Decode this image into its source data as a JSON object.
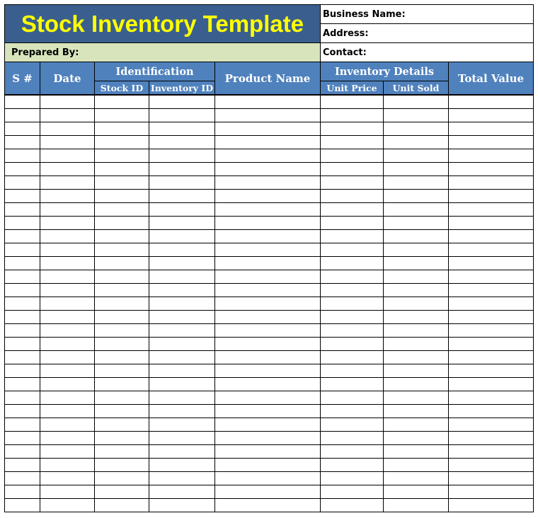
{
  "title": "Stock Inventory Template",
  "info": {
    "business_name_label": "Business Name:",
    "address_label": "Address:",
    "contact_label": "Contact:",
    "prepared_by_label": "Prepared By:"
  },
  "columns": {
    "sno": "S #",
    "date": "Date",
    "identification": "Identification",
    "stock_id": "Stock ID",
    "inventory_id": "Inventory ID",
    "product_name": "Product Name",
    "inventory_details": "Inventory Details",
    "unit_price": "Unit Price",
    "unit_sold": "Unit Sold",
    "total_value": "Total Value"
  },
  "colors": {
    "title_bg": "#3a5f8f",
    "title_text": "#ffff00",
    "header_bg": "#4f81bd",
    "prepared_bg": "#d8e4bc"
  },
  "row_count": 31
}
